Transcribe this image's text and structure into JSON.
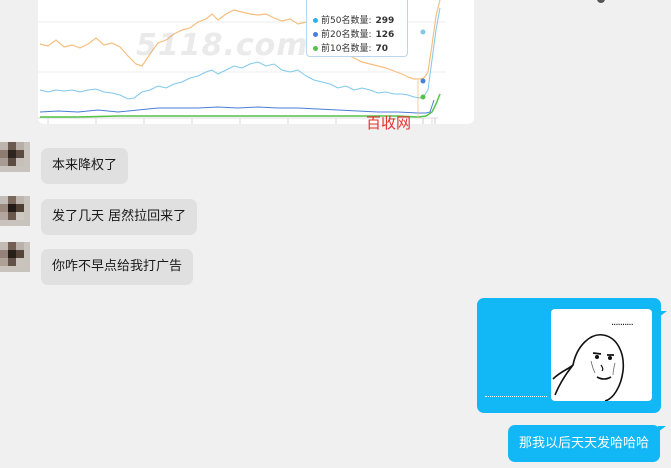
{
  "chart_preview": {
    "watermark": "5118.com",
    "source_label": "百收网",
    "tooltip": {
      "rows": [
        {
          "label": "前50名数量:",
          "value": "299",
          "color": "#2fb2e7"
        },
        {
          "label": "前20名数量:",
          "value": "126",
          "color": "#4a7fd8"
        },
        {
          "label": "前10名数量:",
          "value": "70",
          "color": "#55c24a"
        }
      ]
    },
    "colors": {
      "top50": "#f6bf7f",
      "top20": "#7fc8ea",
      "top10": "#55c24a",
      "top5": "#4a7fd8"
    }
  },
  "chat": {
    "messages": [
      {
        "side": "left",
        "type": "text",
        "text": "本来降权了"
      },
      {
        "side": "left",
        "type": "text",
        "text": "发了几天 居然拉回来了"
      },
      {
        "side": "left",
        "type": "text",
        "text": "你咋不早点给我打广告"
      },
      {
        "side": "right",
        "type": "sticker",
        "sticker_icon": "meme-face-icon",
        "sticker_text": ".........."
      },
      {
        "side": "right",
        "type": "text",
        "text": "那我以后天天发哈哈哈"
      }
    ],
    "colors": {
      "incoming_bubble": "#e0e0e0",
      "outgoing_bubble": "#12b7f5",
      "background": "#f0f0f0"
    }
  }
}
